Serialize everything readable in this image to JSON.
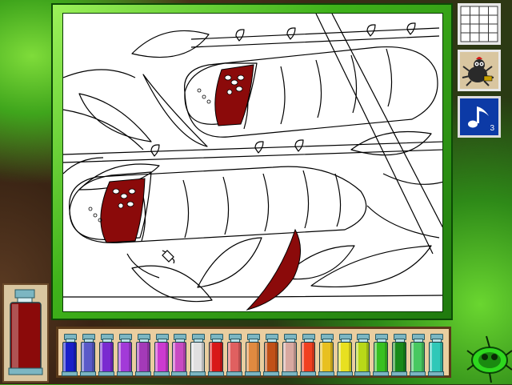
{
  "app": {
    "tool_icons": {
      "grid": "grid-icon",
      "sticker": "spider-sticker-icon",
      "music": "music-note-icon"
    },
    "music_track_number": "3"
  },
  "canvas": {
    "fill_color": "#8b0a0a",
    "line_color": "#000000",
    "background": "#ffffff"
  },
  "current_paint": {
    "color": "#8b0a0a",
    "icon": "paint-jar-icon"
  },
  "palette": {
    "colors": [
      "#1a20c8",
      "#5a5ac8",
      "#7a2ad0",
      "#a23ad8",
      "#a43ab8",
      "#cc3ad0",
      "#c84ac2",
      "#e0e0e0",
      "#d81818",
      "#e06060",
      "#e08a40",
      "#c05018",
      "#d8a8a0",
      "#f04020",
      "#e8c020",
      "#e8e020",
      "#b8d818",
      "#38c020",
      "#1a8a1a",
      "#48c860",
      "#30c8b8"
    ]
  },
  "cursor": {
    "icon": "paint-bucket-cursor-icon"
  },
  "mascot": {
    "icon": "green-bug-icon"
  }
}
